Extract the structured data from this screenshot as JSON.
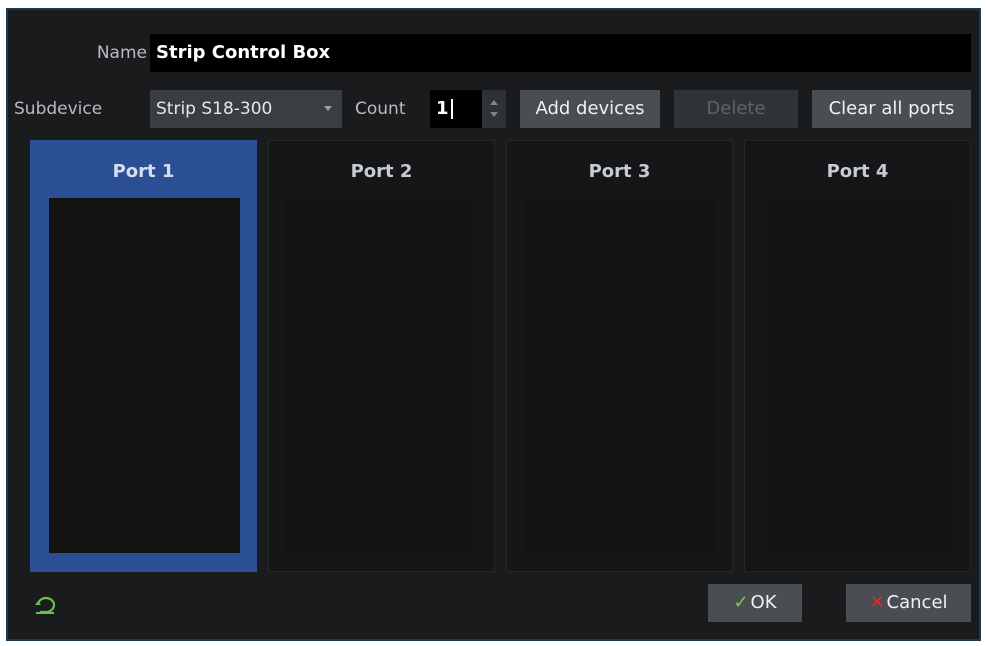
{
  "form": {
    "name_label": "Name",
    "name_value": "Strip Control Box",
    "subdevice_label": "Subdevice",
    "subdevice_value": "Strip S18-300",
    "count_label": "Count",
    "count_value": "1"
  },
  "toolbar": {
    "add_devices": "Add devices",
    "delete": "Delete",
    "clear_all_ports": "Clear all ports"
  },
  "ports": [
    {
      "title": "Port 1",
      "selected": true
    },
    {
      "title": "Port 2",
      "selected": false
    },
    {
      "title": "Port 3",
      "selected": false
    },
    {
      "title": "Port 4",
      "selected": false
    }
  ],
  "footer": {
    "ok_mark": "✓",
    "ok_label": "OK",
    "cancel_mark": "✕",
    "cancel_label": "Cancel",
    "icon": "undo-icon"
  },
  "colors": {
    "accent": "#2a4f94",
    "ok_check": "#7ed13a",
    "cancel_x": "#e02b2b"
  }
}
